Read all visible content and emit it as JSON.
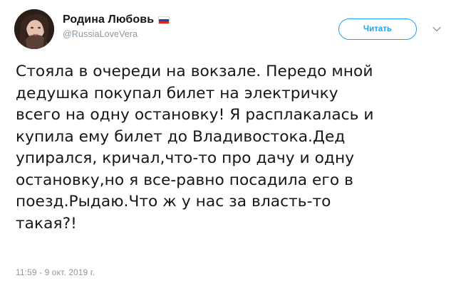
{
  "author": {
    "display_name": "Родина Любовь",
    "handle": "@RussiaLoveVera",
    "flag": "russia-flag"
  },
  "follow_button": {
    "label": "Читать",
    "color": "#1da1f2"
  },
  "menu": {
    "icon": "chevron-down-icon"
  },
  "tweet": {
    "text": "Стояла в очереди на вокзале. Передо мной\nдедушка покупал билет на электричку\nвсего на одну остановку! Я расплакалась и\nкупила ему билет до Владивостока.Дед\nупирался, кричал,что-то про дачу и одну\nостановку,но я все-равно посадила его в\nпоезд.Рыдаю.Что ж у нас за власть-то\nтакая?!",
    "timestamp": "11:59 - 9 окт. 2019 г."
  }
}
